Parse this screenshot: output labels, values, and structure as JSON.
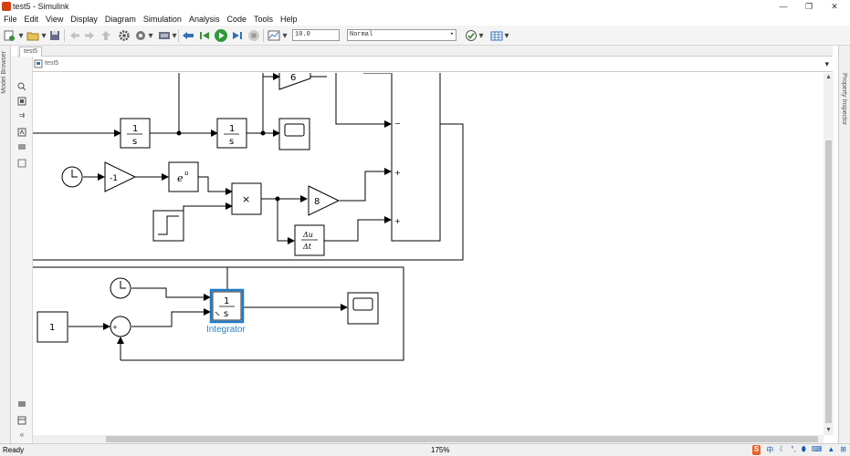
{
  "window": {
    "title": "test5 - Simulink",
    "minimize": "—",
    "restore": "❐",
    "close": "✕"
  },
  "menu": [
    "File",
    "Edit",
    "View",
    "Display",
    "Diagram",
    "Simulation",
    "Analysis",
    "Code",
    "Tools",
    "Help"
  ],
  "toolbar": {
    "stop_time": "10.0",
    "mode": "Normal"
  },
  "tab": {
    "label": "test5"
  },
  "breadcrumb": {
    "model": "test5"
  },
  "side_panels": {
    "left": "Model Browser",
    "right": "Property Inspector"
  },
  "diagram": {
    "labels": {
      "integrator_s_label": "s",
      "integrator_one": "1",
      "gain_top": "6",
      "gain_neg": "-1",
      "exp_fn": "e",
      "exp_sup": "u",
      "product": "×",
      "gain_8": "8",
      "deriv_top": "Δu",
      "deriv_bottom": "Δt",
      "sum_plus": "+",
      "sum_minus": "−",
      "const_one": "1",
      "integrator_name": "Integrator"
    }
  },
  "status": {
    "text": "Ready",
    "zoom": "175%"
  },
  "tray": {
    "ime_label": "中"
  },
  "colors": {
    "selected": "#1e7bc8",
    "label_blue": "#2a7fc0",
    "line": "#000000"
  }
}
